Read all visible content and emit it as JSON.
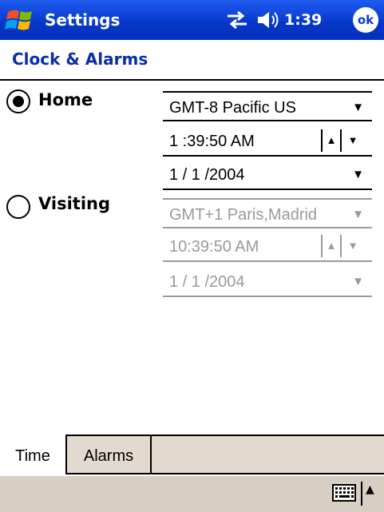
{
  "titlebar": {
    "app_title": "Settings",
    "clock": "1:39",
    "ok_label": "ok",
    "start_icon": "windows-flag-icon",
    "connectivity_icon": "connectivity-arrows-icon",
    "volume_icon": "speaker-volume-icon",
    "color": "#0a3bd6"
  },
  "page": {
    "title": "Clock & Alarms",
    "title_color": "#0b2ea6"
  },
  "home": {
    "label": "Home",
    "selected": true,
    "timezone": "GMT-8 Pacific US",
    "time": "1 :39:50 AM",
    "date": "1 / 1 /2004"
  },
  "visiting": {
    "label": "Visiting",
    "selected": false,
    "timezone": "GMT+1 Paris,Madrid",
    "time": "10:39:50 AM",
    "date": "1 / 1 /2004"
  },
  "glyphs": {
    "dropdown": "▼",
    "spin_up": "▲",
    "spin_down": "▼",
    "sip_up": "▲"
  },
  "tabs": [
    {
      "label": "Time",
      "active": true
    },
    {
      "label": "Alarms",
      "active": false
    }
  ],
  "menubar": {
    "keyboard_icon": "keyboard-icon",
    "background": "#d8cfc4"
  }
}
